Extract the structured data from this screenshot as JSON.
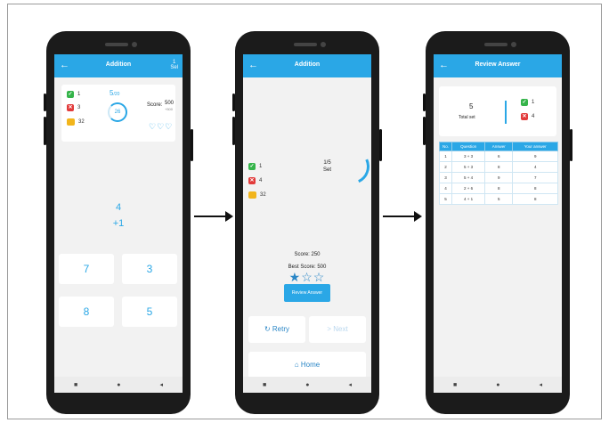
{
  "screens": [
    {
      "title": "Addition",
      "back_icon": "arrow-left-icon",
      "menu_label": "1\nSel",
      "correct": "1",
      "wrong": "3",
      "coins": "32",
      "progress": "5",
      "progress_total": "/20",
      "timer": "26",
      "score_label": "Score:",
      "score_value": "500",
      "score_sub": "+500",
      "hearts": "♡♡♡",
      "question_top": "4",
      "question_bottom": "+1",
      "answers": [
        "7",
        "3",
        "8",
        "5"
      ]
    },
    {
      "title": "Addition",
      "correct": "1",
      "wrong": "4",
      "coins": "32",
      "set_fraction": "1/5",
      "set_label": "Set",
      "score_text": "Score: 250",
      "best_score_text": "Best Score: 500",
      "stars": "★☆☆",
      "review_button": "Review Answer",
      "retry_label": "↻ Retry",
      "next_label": "> Next",
      "home_label": "⌂ Home"
    },
    {
      "title": "Review Answer",
      "total_value": "5",
      "total_label": "Total set",
      "correct": "1",
      "wrong": "4",
      "table_headers": [
        "No.",
        "Question",
        "Answer",
        "Your answer"
      ],
      "table_rows": [
        [
          "1",
          "3 + 3",
          "6",
          "9"
        ],
        [
          "2",
          "5 + 3",
          "8",
          "4"
        ],
        [
          "3",
          "5 + 4",
          "9",
          "7"
        ],
        [
          "4",
          "2 + 6",
          "8",
          "8"
        ],
        [
          "5",
          "4 + 1",
          "5",
          "8"
        ]
      ]
    }
  ],
  "nav_icons": [
    "square-icon",
    "circle-icon",
    "triangle-back-icon"
  ],
  "nav_glyphs": [
    "■",
    "●",
    "◂"
  ],
  "colors": {
    "accent": "#2aa7e6",
    "correct": "#35b44a",
    "wrong": "#e23b3b",
    "coins": "#f2b51c"
  }
}
